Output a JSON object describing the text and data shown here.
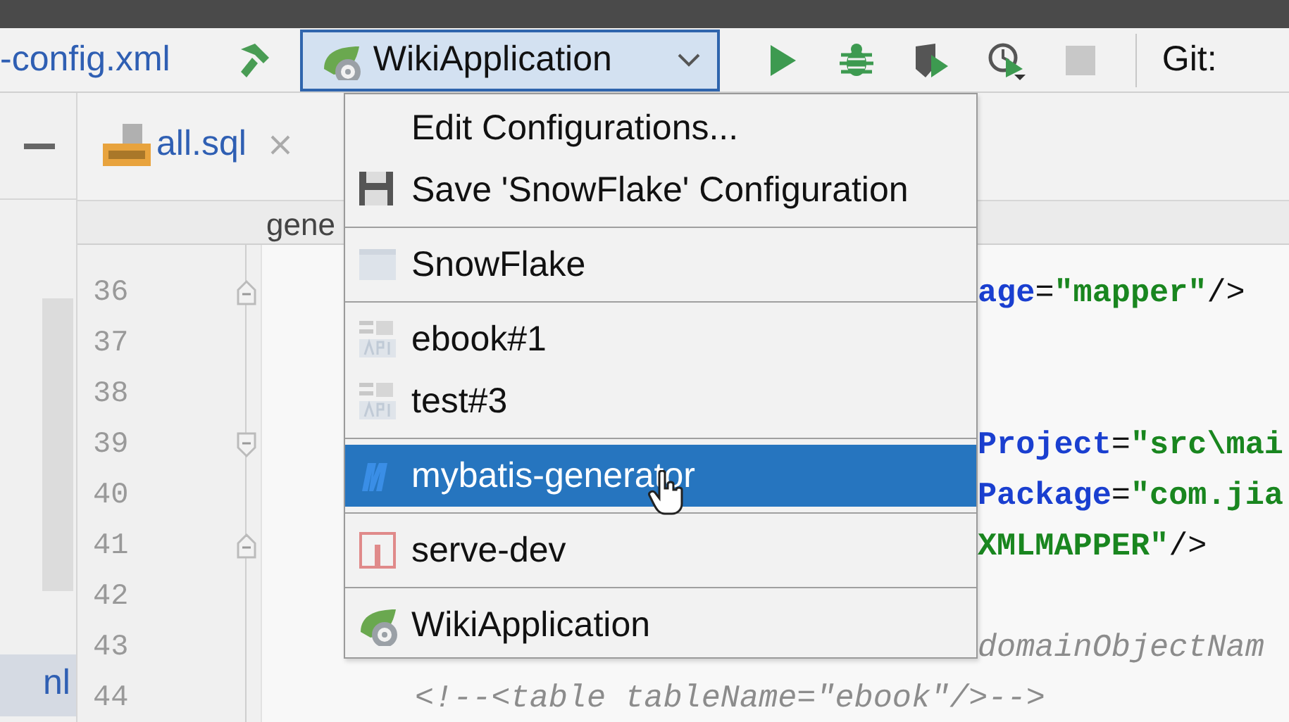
{
  "toolbar": {
    "file_label": "-config.xml",
    "run_config": "WikiApplication",
    "buttons": [
      {
        "kind": "build",
        "disabled": false
      },
      {
        "kind": "run",
        "disabled": false
      },
      {
        "kind": "debug",
        "disabled": false
      },
      {
        "kind": "coverage",
        "disabled": false
      },
      {
        "kind": "profile",
        "disabled": false
      },
      {
        "kind": "stop",
        "disabled": true
      }
    ],
    "vcs_label": "Git:"
  },
  "project_panel": {
    "items": [
      {
        "label": "nl",
        "selected": true
      }
    ]
  },
  "editor_tabs": [
    {
      "label": "all.sql",
      "selected": true
    }
  ],
  "breadcrumb": "gene",
  "code_lines": [
    {
      "number": "36",
      "kind": "fold-start",
      "cut": true,
      "segments": [
        {
          "kind": "attr",
          "text": "age"
        },
        {
          "kind": "punct",
          "text": "="
        },
        {
          "kind": "value",
          "text": "\"mapper\""
        },
        {
          "kind": "punct",
          "text": "/>"
        }
      ]
    },
    {
      "number": "37",
      "kind": "plain"
    },
    {
      "number": "38",
      "kind": "plain"
    },
    {
      "number": "39",
      "kind": "fold-end",
      "cut": true,
      "segments": [
        {
          "kind": "attr",
          "text": "Project"
        },
        {
          "kind": "punct",
          "text": "="
        },
        {
          "kind": "value",
          "text": "\"src\\mai"
        }
      ]
    },
    {
      "number": "40",
      "kind": "plain",
      "cut": true,
      "segments": [
        {
          "kind": "attr",
          "text": "Package"
        },
        {
          "kind": "punct",
          "text": "="
        },
        {
          "kind": "value",
          "text": "\"com.jia"
        }
      ]
    },
    {
      "number": "41",
      "kind": "fold-start",
      "cut": true,
      "segments": [
        {
          "kind": "value",
          "text": "XMLMAPPER\""
        },
        {
          "kind": "punct",
          "text": "/>"
        }
      ]
    },
    {
      "number": "42",
      "kind": "plain"
    },
    {
      "number": "43",
      "kind": "plain",
      "cut": true,
      "segments": [
        {
          "kind": "comment",
          "text": "domainObjectNam"
        }
      ]
    },
    {
      "number": "44",
      "kind": "plain",
      "cut": false,
      "segments": [
        {
          "kind": "comment",
          "text": "        <!--<table tableName=\"ebook\"/>-->"
        }
      ]
    }
  ],
  "run_menu": {
    "groups": [
      [
        {
          "label": "Edit Configurations...",
          "kind": "action",
          "selected": false
        },
        {
          "label": "Save 'SnowFlake' Configuration",
          "kind": "save",
          "selected": false
        }
      ],
      [
        {
          "label": "SnowFlake",
          "kind": "app",
          "selected": false
        }
      ],
      [
        {
          "label": "ebook#1",
          "kind": "api",
          "selected": false
        },
        {
          "label": "test#3",
          "kind": "api",
          "selected": false
        }
      ],
      [
        {
          "label": "mybatis-generator",
          "kind": "mybatis",
          "selected": true
        }
      ],
      [
        {
          "label": "serve-dev",
          "kind": "server",
          "selected": false
        }
      ],
      [
        {
          "label": "WikiApplication",
          "kind": "spring",
          "selected": false
        }
      ]
    ]
  }
}
